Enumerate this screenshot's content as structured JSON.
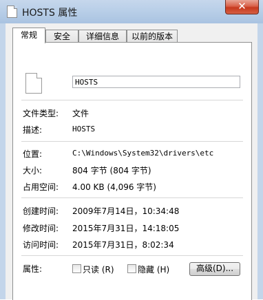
{
  "window": {
    "title": "HOSTS 属性",
    "close_label": "✕"
  },
  "tabs": [
    {
      "label": "常规",
      "active": true
    },
    {
      "label": "安全",
      "active": false
    },
    {
      "label": "详细信息",
      "active": false
    },
    {
      "label": "以前的版本",
      "active": false
    }
  ],
  "general": {
    "file_icon": "document-icon",
    "name_value": "HOSTS",
    "type_label": "文件类型:",
    "type_value": "文件",
    "desc_label": "描述:",
    "desc_value": "HOSTS",
    "location_label": "位置:",
    "location_value": "C:\\Windows\\System32\\drivers\\etc",
    "size_label": "大小:",
    "size_value": "804 字节 (804 字节)",
    "disk_label": "占用空间:",
    "disk_value": "4.00 KB (4,096 字节)",
    "created_label": "创建时间:",
    "created_value": "2009年7月14日，10:34:48",
    "modified_label": "修改时间:",
    "modified_value": "2015年7月31日，14:18:05",
    "accessed_label": "访问时间:",
    "accessed_value": "2015年7月31日，8:02:34",
    "attr_label": "属性:",
    "readonly_label": "只读 (R)",
    "readonly_checked": false,
    "hidden_label": "隐藏 (H)",
    "hidden_checked": false,
    "advanced_label": "高级(D)..."
  }
}
